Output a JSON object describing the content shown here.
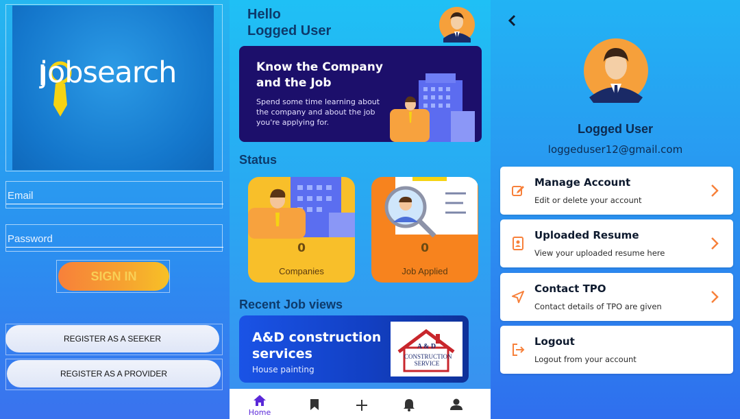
{
  "colors": {
    "accent": "#f7803a",
    "primary": "#1c0f6b",
    "brand_yellow": "#f6d313",
    "nav_active": "#5a28d8"
  },
  "login": {
    "logo_text": "jobsearch",
    "email_placeholder": "Email",
    "password_placeholder": "Password",
    "signin_label": "SIGN IN",
    "register_seeker_label": "REGISTER AS A SEEKER",
    "register_provider_label": "REGISTER AS A PROVIDER"
  },
  "home": {
    "greeting_line1": "Hello",
    "greeting_line2": "Logged User",
    "banner": {
      "title": "Know the Company and the Job",
      "subtitle": "Spend some time learning about the company and about the job you're applying for."
    },
    "status_heading": "Status",
    "stats": [
      {
        "value": "0",
        "label": "Companies",
        "color": "#f8bf2a"
      },
      {
        "value": "0",
        "label": "Job Applied",
        "color": "#f7831e"
      }
    ],
    "recent_heading": "Recent Job views",
    "recent_job": {
      "title": "A&D construction services",
      "subtitle": "House painting",
      "logo_text_top": "A & D",
      "logo_text_bottom": "CONSTRUCTION SERVICE"
    },
    "nav": [
      {
        "label": "Home",
        "icon": "home-icon",
        "active": true
      },
      {
        "label": "",
        "icon": "bookmark-icon",
        "active": false
      },
      {
        "label": "",
        "icon": "plus-icon",
        "active": false
      },
      {
        "label": "",
        "icon": "bell-icon",
        "active": false
      },
      {
        "label": "",
        "icon": "person-icon",
        "active": false
      }
    ]
  },
  "profile": {
    "name": "Logged User",
    "email": "loggeduser12@gmail.com",
    "menu": [
      {
        "title": "Manage Account",
        "subtitle": "Edit or delete your account",
        "icon": "edit-icon"
      },
      {
        "title": "Uploaded Resume",
        "subtitle": "View your uploaded resume here",
        "icon": "resume-icon"
      },
      {
        "title": "Contact TPO",
        "subtitle": "Contact details of TPO are given",
        "icon": "send-icon"
      },
      {
        "title": "Logout",
        "subtitle": "Logout from your account",
        "icon": "logout-icon"
      }
    ]
  }
}
